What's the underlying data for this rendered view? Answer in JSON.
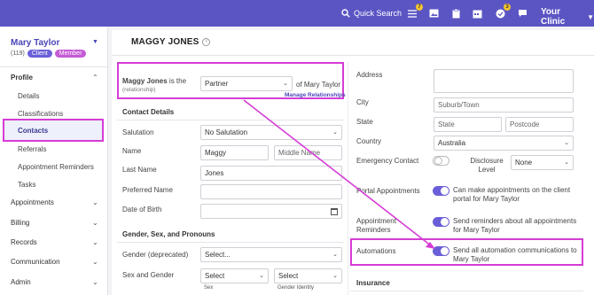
{
  "topbar": {
    "search_label": "Quick Search",
    "badge_tasks": "7",
    "badge_notifications": "3",
    "clinic_label": "Your Clinic"
  },
  "sidebar": {
    "client_name": "Mary Taylor",
    "client_id": "(119)",
    "tags": [
      {
        "label": "Client",
        "color": "#6a5fd8"
      },
      {
        "label": "Member",
        "color": "#c55bd6"
      }
    ],
    "profile_label": "Profile",
    "profile_items": [
      "Details",
      "Classifications",
      "Contacts",
      "Referrals",
      "Appointment Reminders",
      "Tasks"
    ],
    "active_item": "Contacts",
    "sections": [
      "Appointments",
      "Billing",
      "Records",
      "Communication",
      "Admin"
    ]
  },
  "main": {
    "title": "MAGGY JONES",
    "relationship": {
      "label_name": "Maggy Jones",
      "label_suffix": "is the",
      "sublabel": "(relationship)",
      "value": "Partner",
      "of_text": "of Mary Taylor",
      "manage_link": "Manage Relationships"
    },
    "contact_details": {
      "heading": "Contact Details",
      "salutation_label": "Salutation",
      "salutation_value": "No Salutation",
      "name_label": "Name",
      "first_name": "Maggy",
      "middle_name_placeholder": "Middle Name",
      "last_name_label": "Last Name",
      "last_name": "Jones",
      "preferred_name_label": "Preferred Name",
      "dob_label": "Date of Birth"
    },
    "gender": {
      "heading": "Gender, Sex, and Pronouns",
      "deprecated_label": "Gender (deprecated)",
      "deprecated_value": "Select...",
      "sex_gender_label": "Sex and Gender",
      "sex_value": "Select",
      "gender_identity_value": "Select",
      "sex_caption": "Sex",
      "gender_identity_caption": "Gender Identity"
    },
    "address": {
      "address_label": "Address",
      "city_label": "City",
      "city_placeholder": "Suburb/Town",
      "state_label": "State",
      "state_placeholder": "State",
      "postcode_placeholder": "Postcode",
      "country_label": "Country",
      "country_value": "Australia",
      "emergency_label": "Emergency Contact",
      "disclosure_label": "Disclosure Level",
      "disclosure_value": "None",
      "portal_label": "Portal Appointments",
      "portal_text": "Can make appointments on the client portal for Mary Taylor",
      "reminders_label": "Appointment Reminders",
      "reminders_text": "Send reminders about all appointments for Mary Taylor",
      "automations_label": "Automations",
      "automations_text": "Send all automation communications to Mary Taylor",
      "insurance_heading": "Insurance"
    }
  }
}
